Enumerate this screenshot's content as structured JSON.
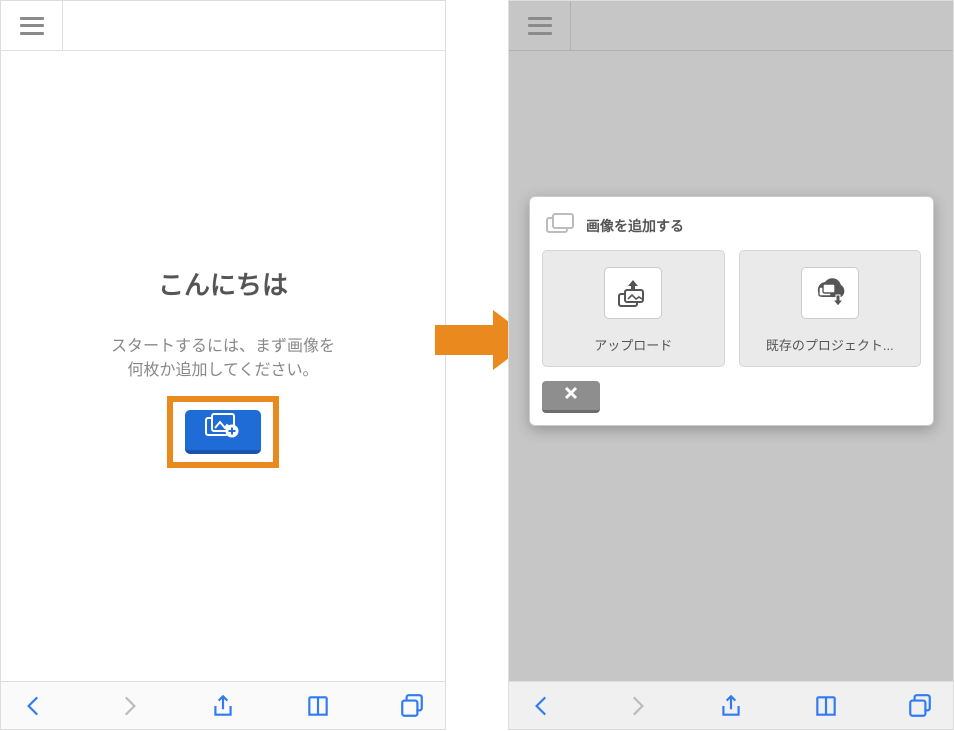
{
  "left": {
    "greeting": "こんにちは",
    "subtitle_line1": "スタートするには、まず画像を",
    "subtitle_line2": "何枚か追加してください。"
  },
  "right": {
    "dialog": {
      "title": "画像を追加する",
      "options": {
        "upload": "アップロード",
        "existing": "既存のプロジェクト..."
      }
    }
  }
}
